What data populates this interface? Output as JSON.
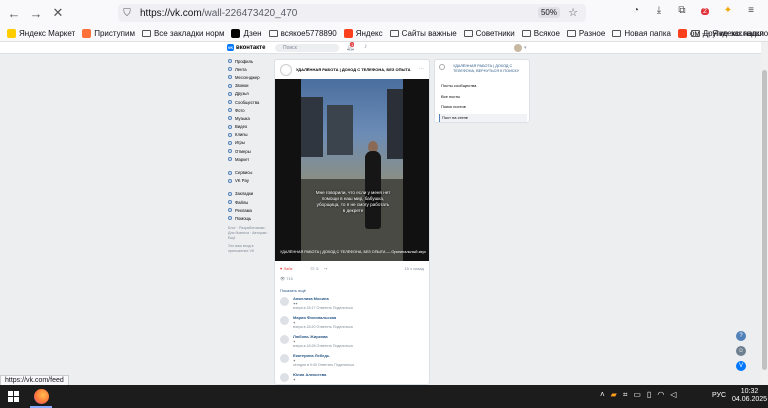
{
  "browser": {
    "url_host": "https://vk.com",
    "url_path": "/wall-226473420_470",
    "zoom": "50%",
    "status_url": "https://vk.com/feed",
    "bookmarks": [
      {
        "label": "Яндекс Маркет",
        "color": "#ffcc00"
      },
      {
        "label": "Приступим",
        "color": "#ff7139"
      },
      {
        "label": "Все закладки норм",
        "color": "folder"
      },
      {
        "label": "Дзен",
        "color": "#000000"
      },
      {
        "label": "всякое5778890",
        "color": "folder"
      },
      {
        "label": "Яндекс",
        "color": "#fc3f1d"
      },
      {
        "label": "Сайты важные",
        "color": "folder"
      },
      {
        "label": "Советники",
        "color": "folder"
      },
      {
        "label": "Всякое",
        "color": "folder"
      },
      {
        "label": "Разное",
        "color": "folder"
      },
      {
        "label": "Новая папка",
        "color": "folder"
      },
      {
        "label": "ом — Яндекс: нашло...",
        "color": "#fc3f1d"
      }
    ],
    "bookmarks_other": "Другие закладки"
  },
  "vk": {
    "logo": "вконтакте",
    "search_placeholder": "Поиск",
    "notif_count": "1",
    "nav": [
      "Профиль",
      "Лента",
      "Мессенджер",
      "Звонки",
      "Друзья",
      "Сообщества",
      "Фото",
      "Музыка",
      "Видео",
      "Клипы",
      "Игры",
      "Отмеры",
      "Маркет",
      "Сервисы",
      "VK Pay",
      "Закладки",
      "Файлы",
      "Реклама",
      "Помощь"
    ],
    "nav_footer": "Блог · Разработчикам · Для бизнеса · Авторам · Ещё",
    "nav_note": "Это ваш вход в приложение VK",
    "post": {
      "title": "УДАЛЁННАЯ РАБОТА | ДОХОД С ТЕЛЕФОНА, БЕЗ ОПЫТА",
      "subtitle": "Мне говорили, что если у меня нет помощи в наш мир, бабушка, уборщица, то я не смогу работать в декрете",
      "video_footer": "УДАЛЁННАЯ РАБОТА | ДОХОД С ТЕЛЕФОНА, БЕЗ ОПЫТА — Оригинальный звук",
      "likes": "Лайк",
      "comments": "5",
      "time": "15 ч назад",
      "views": "715",
      "show_prev": "Показать ещё",
      "comments_list": [
        {
          "name": "Анжелика Мосина",
          "text": "++",
          "meta": "вчера в 18:17  Ответить  Поделиться"
        },
        {
          "name": "Мария Филопальская",
          "text": "+",
          "meta": "вчера в 18:20  Ответить  Поделиться"
        },
        {
          "name": "Любовь Жиркова",
          "text": "+",
          "meta": "вчера в 18:28  Ответить  Поделиться"
        },
        {
          "name": "Екатерина Лебедь",
          "text": "+",
          "meta": "сегодня в 9:40  Ответить  Поделиться"
        },
        {
          "name": "Юлия Алексеева",
          "text": "+",
          "meta": ""
        }
      ]
    },
    "right_menu": {
      "top": "УДАЛЁННАЯ РАБОТА | ДОХОД С ТЕЛЕФОНА, ВЕРНУТЬСЯ К ПОИСКУ",
      "items": [
        "Посты сообщества",
        "Все посты",
        "Поиск постов",
        "Пост на стене"
      ]
    }
  },
  "taskbar": {
    "lang": "РУС",
    "time": "10:32",
    "date": "04.06.2025"
  }
}
